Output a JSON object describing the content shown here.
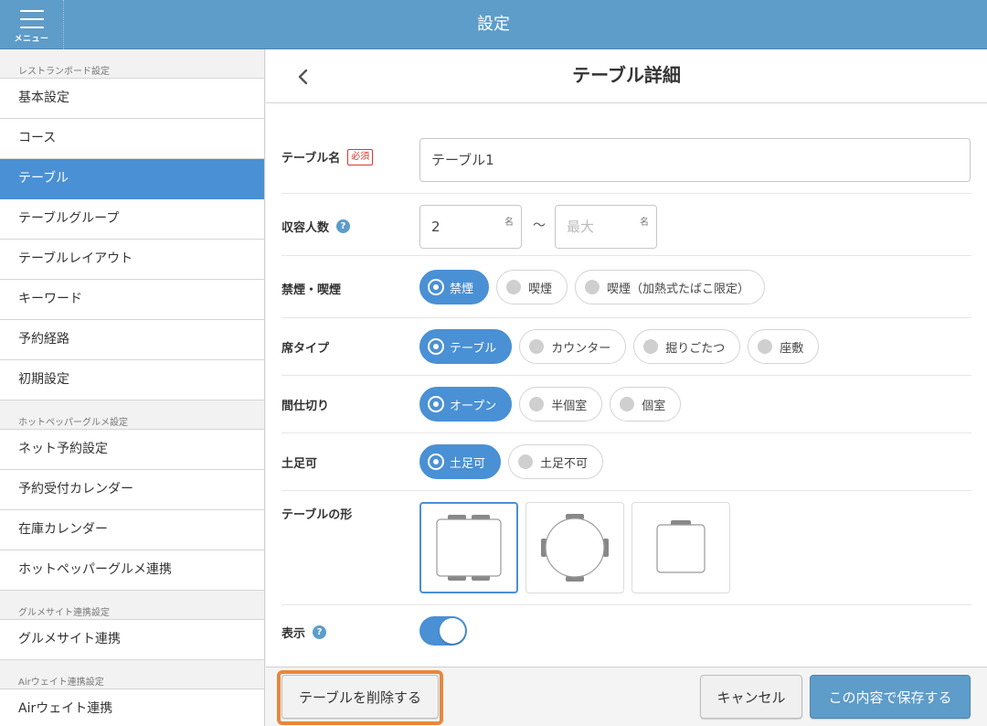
{
  "header": {
    "menu_label": "メニュー",
    "title": "設定"
  },
  "sidebar": {
    "sections": [
      {
        "title": "レストランボード設定",
        "items": [
          "基本設定",
          "コース",
          "テーブル",
          "テーブルグループ",
          "テーブルレイアウト",
          "キーワード",
          "予約経路",
          "初期設定"
        ]
      },
      {
        "title": "ホットペッパーグルメ設定",
        "items": [
          "ネット予約設定",
          "予約受付カレンダー",
          "在庫カレンダー",
          "ホットペッパーグルメ連携"
        ]
      },
      {
        "title": "グルメサイト連携設定",
        "items": [
          "グルメサイト連携"
        ]
      },
      {
        "title": "Airウェイト連携設定",
        "items": [
          "Airウェイト連携"
        ]
      }
    ],
    "active_item": "テーブル"
  },
  "main": {
    "title": "テーブル詳細",
    "form": {
      "name": {
        "label": "テーブル名",
        "required_badge": "必須",
        "value": "テーブル1"
      },
      "capacity": {
        "label": "収容人数",
        "help": "?",
        "min_value": "2",
        "min_unit": "名",
        "separator": "〜",
        "max_placeholder": "最大",
        "max_unit": "名"
      },
      "smoking": {
        "label": "禁煙・喫煙",
        "options": [
          "禁煙",
          "喫煙",
          "喫煙（加熱式たばこ限定）"
        ],
        "selected": 0
      },
      "seat_type": {
        "label": "席タイプ",
        "options": [
          "テーブル",
          "カウンター",
          "掘りごたつ",
          "座敷"
        ],
        "selected": 0
      },
      "partition": {
        "label": "間仕切り",
        "options": [
          "オープン",
          "半個室",
          "個室"
        ],
        "selected": 0
      },
      "shoes": {
        "label": "土足可",
        "options": [
          "土足可",
          "土足不可"
        ],
        "selected": 0
      },
      "shape": {
        "label": "テーブルの形",
        "options": [
          "square-table-icon",
          "round-table-icon",
          "single-seat-table-icon"
        ],
        "selected": 0
      },
      "display": {
        "label": "表示",
        "help": "?",
        "enabled": true
      }
    }
  },
  "footer": {
    "delete_label": "テーブルを削除する",
    "cancel_label": "キャンセル",
    "save_label": "この内容で保存する"
  },
  "colors": {
    "header": "#5e9cc9",
    "accent": "#4a90d4",
    "highlight": "#e9873b",
    "required": "#e0342c"
  }
}
